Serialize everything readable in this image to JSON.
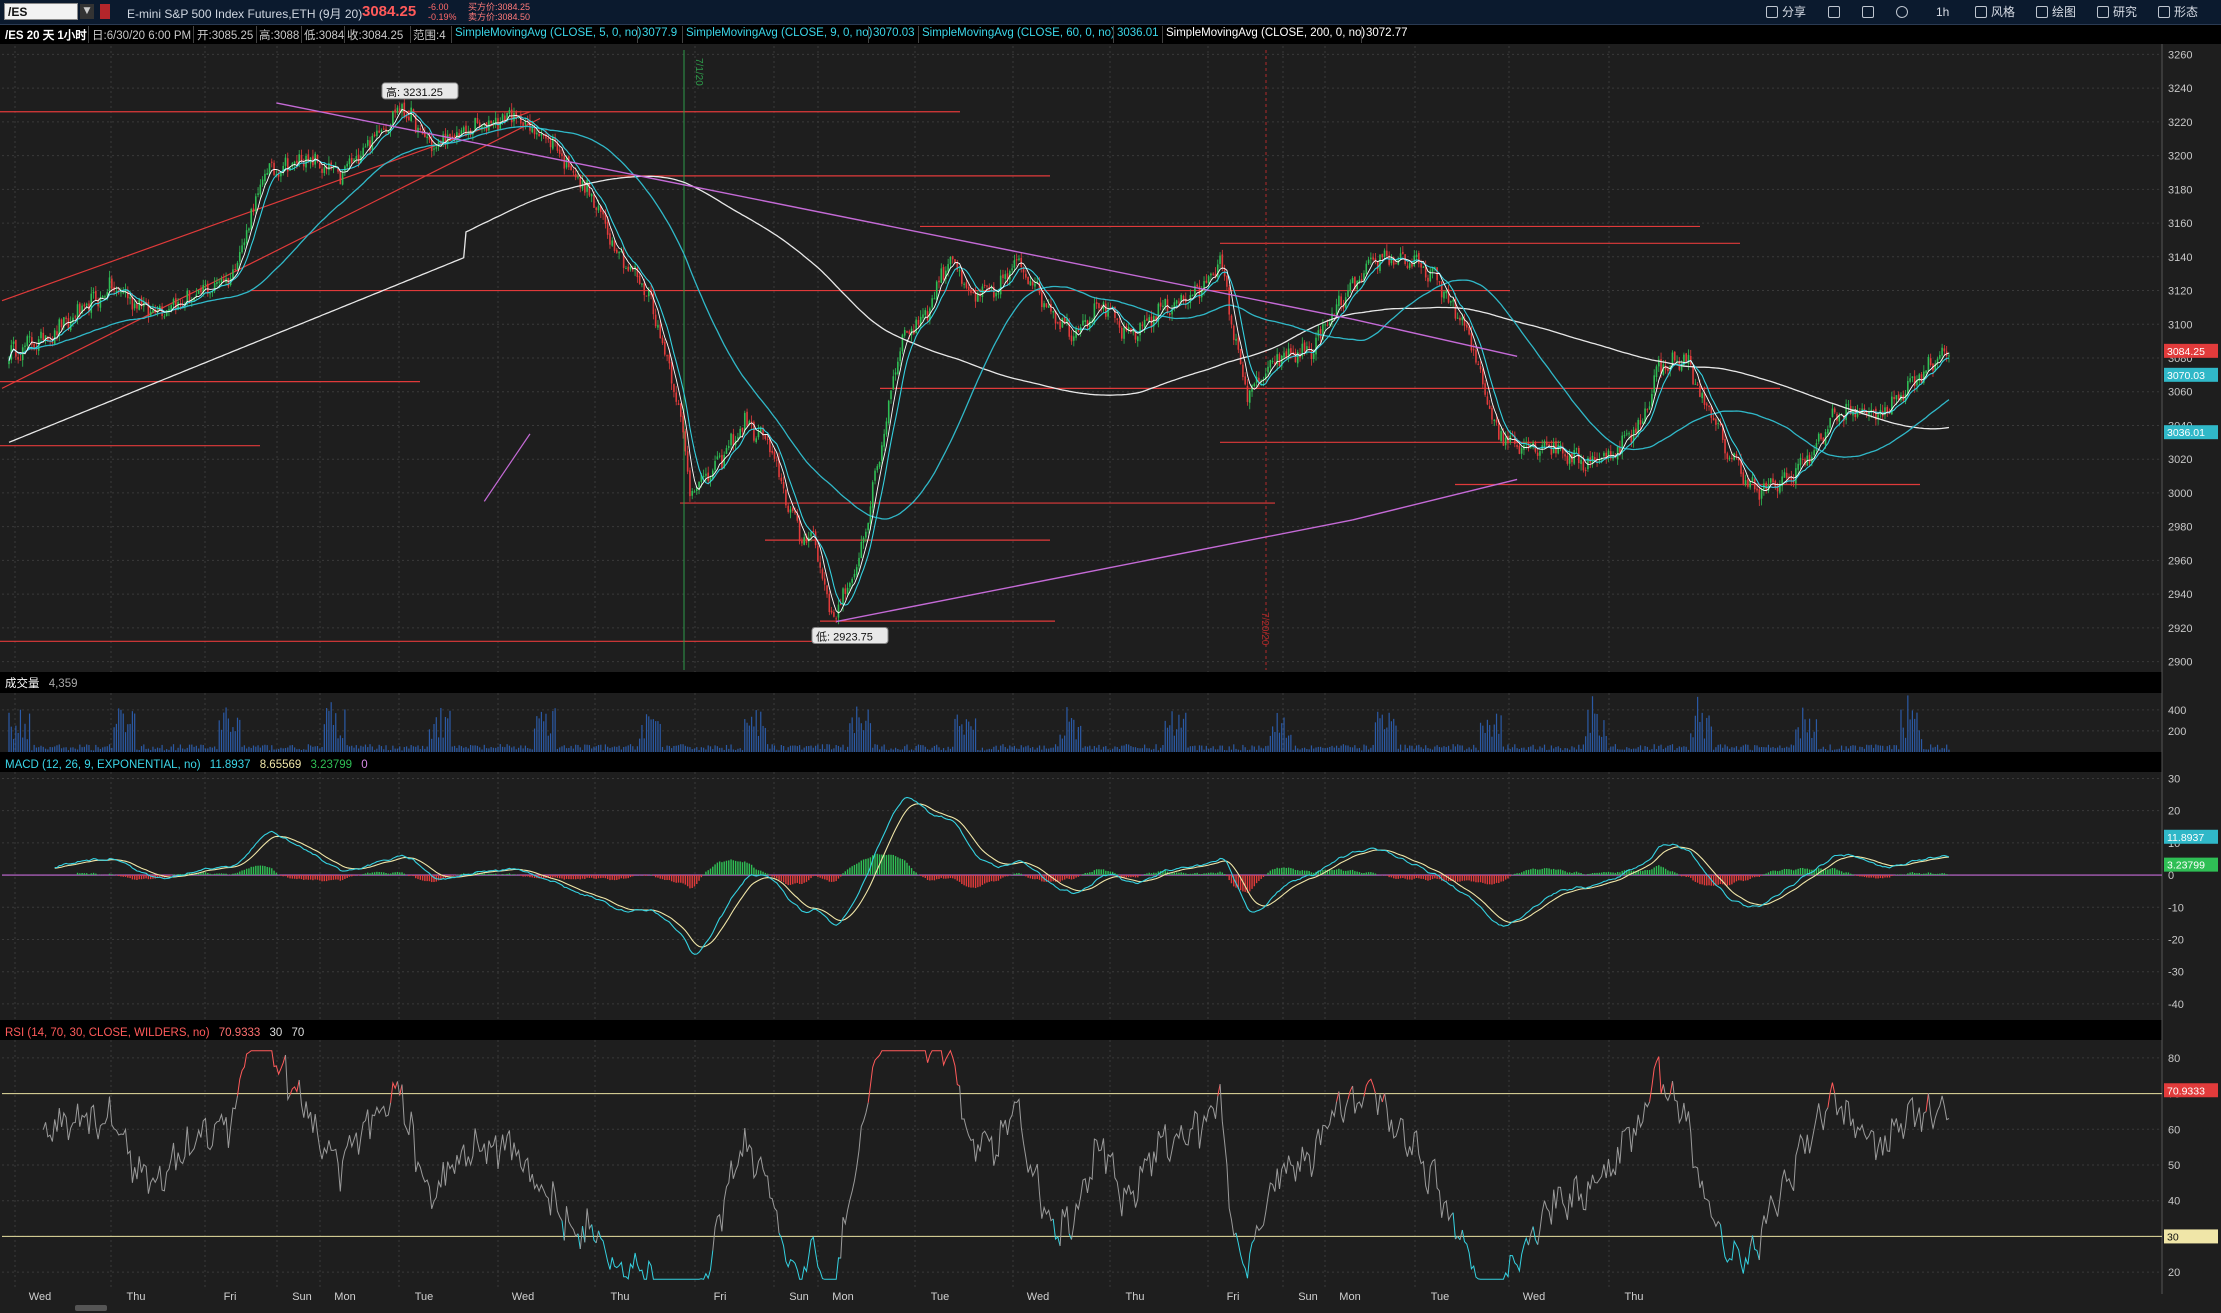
{
  "header": {
    "symbol": "/ES",
    "description": "E-mini S&P 500 Index Futures,ETH (9月 20)",
    "last_price": "3084.25",
    "change": "-6.00",
    "change_pct": "-0.19%",
    "bid": "买方价:3084.25",
    "ask": "卖方价:3084.50",
    "toolbar": [
      "分享",
      "风格",
      "绘图",
      "研究",
      "形态"
    ],
    "interval": "1h"
  },
  "info_bar": {
    "period": "/ES 20 天 1小时",
    "date": "日:6/30/20 6:00 PM",
    "open": "开:3085.25",
    "high": "高:3088",
    "low": "低:3084",
    "close": "收:3084.25",
    "range": "范围:4",
    "studies": [
      {
        "label": "SimpleMovingAvg (CLOSE, 5, 0, no)",
        "value": "3077.9"
      },
      {
        "label": "SimpleMovingAvg (CLOSE, 9, 0, no)",
        "value": "3070.03"
      },
      {
        "label": "SimpleMovingAvg (CLOSE, 60, 0, no)",
        "value": "3036.01"
      },
      {
        "label": "SimpleMovingAvg (CLOSE, 200, 0, no)",
        "value": "3072.77"
      }
    ]
  },
  "colors": {
    "up": "#2fbf55",
    "down": "#e23b3b",
    "sma5": "#ffffff",
    "sma9": "#34d1e0",
    "sma60": "#30b8c8",
    "sma200": "#e8e8e8",
    "trendline": "#c46ad6",
    "level": "#e03a3a",
    "grid": "#3a3a3a"
  },
  "chart_data": [
    {
      "type": "candlestick",
      "panel": "price",
      "ylim": [
        2895,
        3265
      ],
      "y_ticks": [
        2900,
        2920,
        2940,
        2960,
        2980,
        3000,
        3020,
        3040,
        3060,
        3080,
        3100,
        3120,
        3140,
        3160,
        3180,
        3200,
        3220,
        3240,
        3260
      ],
      "x_ticks": [
        "Wed",
        "Thu",
        "Fri",
        "Sun",
        "Mon",
        "Tue",
        "Wed",
        "Thu",
        "Fri",
        "Sun",
        "Mon",
        "Tue",
        "Wed",
        "Thu",
        "Fri",
        "Sun",
        "Mon",
        "Tue",
        "Wed",
        "Thu"
      ],
      "annotations": [
        {
          "text": "高: 3231.25",
          "value": 3231.25
        },
        {
          "text": "低: 2923.75",
          "value": 2923.75
        }
      ],
      "close_anchors": [
        [
          0,
          3082
        ],
        [
          20,
          3095
        ],
        [
          45,
          3122
        ],
        [
          62,
          3108
        ],
        [
          80,
          3115
        ],
        [
          98,
          3130
        ],
        [
          112,
          3190
        ],
        [
          130,
          3198
        ],
        [
          145,
          3188
        ],
        [
          162,
          3215
        ],
        [
          172,
          3229
        ],
        [
          185,
          3205
        ],
        [
          200,
          3214
        ],
        [
          220,
          3224
        ],
        [
          238,
          3208
        ],
        [
          255,
          3175
        ],
        [
          268,
          3140
        ],
        [
          280,
          3118
        ],
        [
          292,
          3060
        ],
        [
          298,
          3003
        ],
        [
          308,
          3012
        ],
        [
          322,
          3042
        ],
        [
          332,
          3030
        ],
        [
          340,
          2998
        ],
        [
          346,
          2974
        ],
        [
          352,
          2975
        ],
        [
          360,
          2926
        ],
        [
          370,
          2950
        ],
        [
          378,
          3000
        ],
        [
          390,
          3090
        ],
        [
          402,
          3108
        ],
        [
          412,
          3142
        ],
        [
          420,
          3116
        ],
        [
          432,
          3120
        ],
        [
          442,
          3138
        ],
        [
          455,
          3110
        ],
        [
          465,
          3095
        ],
        [
          478,
          3112
        ],
        [
          490,
          3092
        ],
        [
          505,
          3110
        ],
        [
          520,
          3118
        ],
        [
          530,
          3138
        ],
        [
          536,
          3095
        ],
        [
          542,
          3058
        ],
        [
          556,
          3080
        ],
        [
          570,
          3085
        ],
        [
          584,
          3115
        ],
        [
          600,
          3140
        ],
        [
          612,
          3138
        ],
        [
          624,
          3128
        ],
        [
          634,
          3106
        ],
        [
          640,
          3088
        ],
        [
          652,
          3034
        ],
        [
          665,
          3028
        ],
        [
          676,
          3028
        ],
        [
          688,
          3018
        ],
        [
          700,
          3022
        ],
        [
          714,
          3040
        ],
        [
          722,
          3075
        ],
        [
          734,
          3079
        ],
        [
          740,
          3060
        ],
        [
          752,
          3025
        ],
        [
          765,
          3000
        ],
        [
          778,
          3008
        ],
        [
          790,
          3025
        ],
        [
          798,
          3045
        ],
        [
          810,
          3049
        ],
        [
          820,
          3046
        ],
        [
          828,
          3060
        ],
        [
          838,
          3072
        ],
        [
          846,
          3084
        ]
      ],
      "levels": [
        3226,
        3188,
        3158,
        3148,
        3120,
        3066,
        3062,
        3030,
        3028,
        3005,
        2994,
        2972,
        2924,
        2912
      ],
      "trend_high": [
        3231.25,
        3103,
        3081
      ],
      "trend_low": [
        2923.75,
        2984,
        3008
      ],
      "last_price_tag": "3084.25",
      "sma_tags": [
        "3070.03",
        "3036.01"
      ],
      "hidden_price_tag": "3080"
    },
    {
      "type": "bar",
      "panel": "volume",
      "title": "成交量",
      "value": "4,359",
      "y_ticks": [
        200,
        400
      ]
    },
    {
      "type": "line",
      "panel": "macd",
      "title": "MACD (12, 26, 9, EXPONENTIAL, no)",
      "values": [
        "11.8937",
        "8.65569",
        "3.23799",
        "0"
      ],
      "ylim": [
        -45,
        32
      ],
      "y_ticks": [
        -40,
        -30,
        -20,
        -10,
        0,
        10,
        20,
        30
      ]
    },
    {
      "type": "line",
      "panel": "rsi",
      "title": "RSI (14, 70, 30, CLOSE, WILDERS, no)",
      "values": [
        "70.9333",
        "30",
        "70"
      ],
      "ylim": [
        15,
        85
      ],
      "y_ticks": [
        20,
        30,
        40,
        50,
        60,
        70,
        80
      ],
      "levels": [
        70,
        30
      ]
    }
  ],
  "right_tags": {
    "macd_value": "11.8937",
    "macd_hist": "3.23799",
    "rsi_value": "70.9333",
    "rsi_level": "30"
  },
  "vertical_labels": [
    "7/1/20",
    "7/20/20"
  ]
}
